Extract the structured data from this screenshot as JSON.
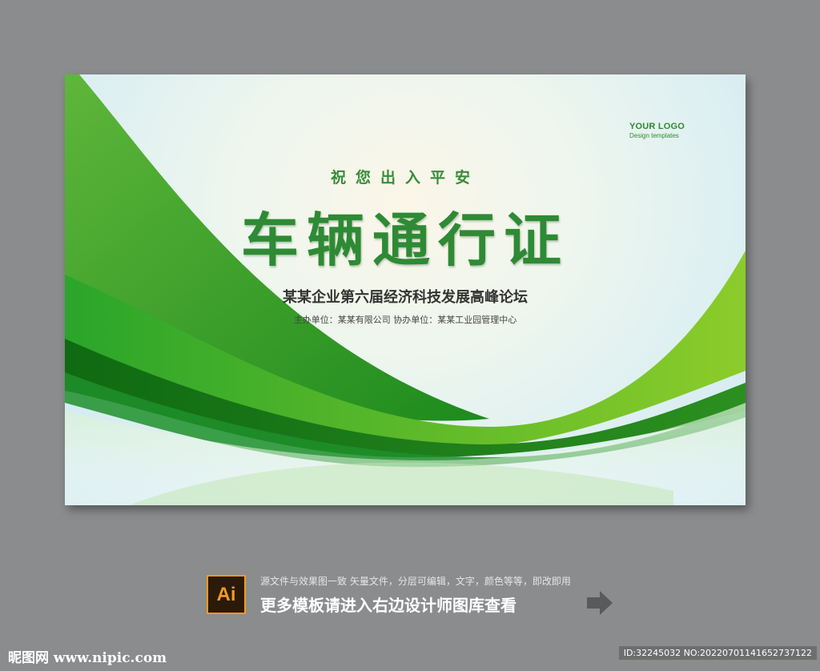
{
  "poster": {
    "logo_text": "YOUR LOGO",
    "logo_sub": "Design templates",
    "blessing": "祝您出入平安",
    "title": "车辆通行证",
    "subtitle": "某某企业第六届经济科技发展高峰论坛",
    "organizers": "主办单位：某某有限公司  协办单位：某某工业园管理中心",
    "colors": {
      "accent": "#2e8a34",
      "wave_dark": "#1c7a1c",
      "wave_light": "#5cc23a"
    }
  },
  "promo": {
    "badge": "Ai",
    "note": "源文件与效果图一致 矢量文件，分层可编辑，文字，颜色等等，即改即用",
    "main": "更多模板请进入右边设计师图库查看",
    "arrow_icon": "arrow-right-icon"
  },
  "footer": {
    "site": "昵图网 www.nipic.com",
    "id": "ID:32245032 NO:20220701141652737122"
  }
}
